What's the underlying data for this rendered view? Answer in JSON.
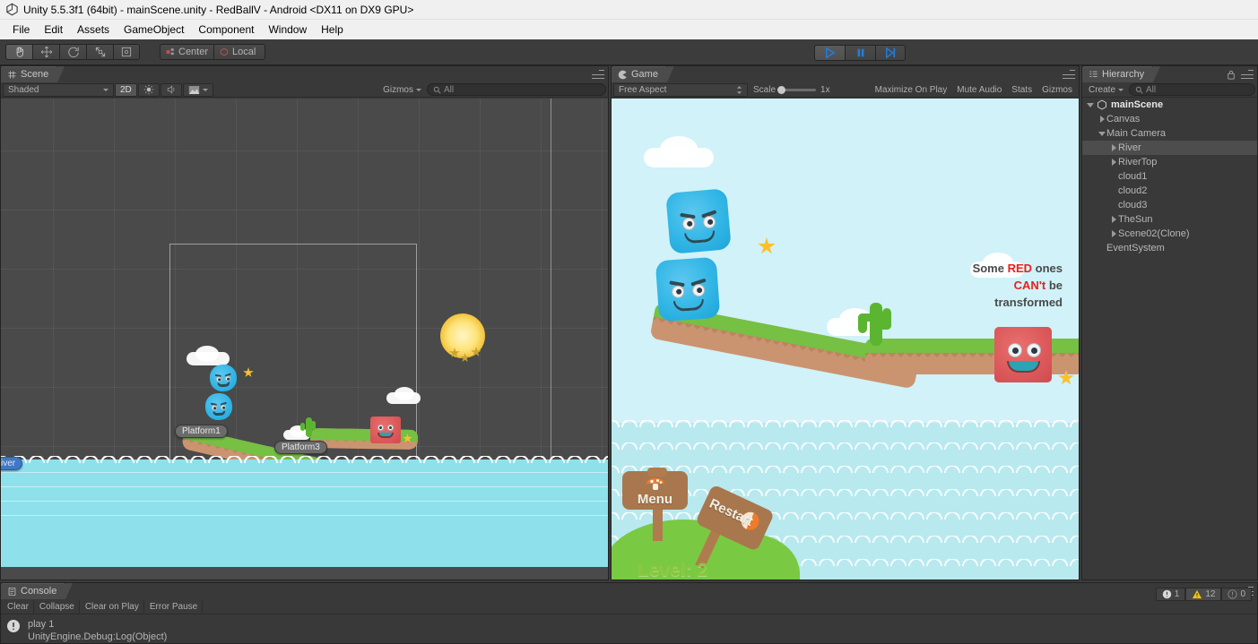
{
  "window": {
    "title": "Unity 5.5.3f1 (64bit) - mainScene.unity - RedBallV - Android <DX11 on DX9 GPU>",
    "logo_icon": "unity-logo-icon"
  },
  "menu": {
    "items": [
      "File",
      "Edit",
      "Assets",
      "GameObject",
      "Component",
      "Window",
      "Help"
    ]
  },
  "toolbar": {
    "tools": [
      {
        "name": "hand-tool",
        "icon": "hand-icon",
        "selected": true
      },
      {
        "name": "move-tool",
        "icon": "move-icon",
        "selected": false
      },
      {
        "name": "rotate-tool",
        "icon": "rotate-icon",
        "selected": false
      },
      {
        "name": "scale-tool",
        "icon": "scale-icon",
        "selected": false
      },
      {
        "name": "rect-tool",
        "icon": "rect-transform-icon",
        "selected": false
      }
    ],
    "pivot_label": "Center",
    "pivot_icon": "pivot-center-icon",
    "space_label": "Local",
    "space_icon": "local-space-icon",
    "play_label": "play-button",
    "pause_label": "pause-button",
    "step_label": "step-button",
    "play_active": true
  },
  "scene_view": {
    "tab_label": "Scene",
    "tab_icon": "scene-grid-icon",
    "shading_mode": "Shaded",
    "toggle_2d": "2D",
    "lighting_icon": "lighting-icon",
    "audio_icon": "audio-icon",
    "fx_icon": "effects-icon",
    "gizmos_label": "Gizmos",
    "search_placeholder": "All",
    "search_icon": "search-icon",
    "gizmo_labels": [
      {
        "name": "gizmo-platform1",
        "text": "Platform1",
        "selected": false
      },
      {
        "name": "gizmo-platform3",
        "text": "Platform3",
        "selected": false
      },
      {
        "name": "gizmo-river",
        "text": "iver",
        "selected": true
      }
    ]
  },
  "game_view": {
    "tab_label": "Game",
    "tab_icon": "game-pacman-icon",
    "aspect": "Free Aspect",
    "scale_label": "Scale",
    "scale_value": "1x",
    "maximize_on_play": "Maximize On Play",
    "mute_audio": "Mute Audio",
    "stats": "Stats",
    "gizmos": "Gizmos",
    "content": {
      "hint_line1_a": "Some ",
      "hint_line1_b": "RED",
      "hint_line1_c": " ones",
      "hint_line2_a": "CAN't",
      "hint_line2_b": " be",
      "hint_line3": "transformed",
      "menu_button": "Menu",
      "menu_icon": "mushroom-icon",
      "restart_button": "Restart",
      "restart_icon": "restart-ball-icon",
      "level_label": "Level: 2",
      "sky_color": "#d0f2f8",
      "water_color": "#b8e9ef",
      "grass_color": "#76c043",
      "dirt_color": "#cb9470",
      "blue_cube_color": "#32b6e6",
      "red_cube_color": "#dd5a5c",
      "star_color": "#fbc02d"
    }
  },
  "hierarchy": {
    "tab_label": "Hierarchy",
    "tab_icon": "hierarchy-icon",
    "lock_icon": "lock-icon",
    "create_label": "Create",
    "search_placeholder": "All",
    "search_icon": "search-icon",
    "items": [
      {
        "label": "mainScene",
        "depth": 0,
        "arrow": "open",
        "selected": false,
        "is_scene": true
      },
      {
        "label": "Canvas",
        "depth": 1,
        "arrow": "closed",
        "selected": false,
        "is_scene": false
      },
      {
        "label": "Main Camera",
        "depth": 1,
        "arrow": "open",
        "selected": false,
        "is_scene": false
      },
      {
        "label": "River",
        "depth": 2,
        "arrow": "closed",
        "selected": true,
        "is_scene": false
      },
      {
        "label": "RiverTop",
        "depth": 2,
        "arrow": "closed",
        "selected": false,
        "is_scene": false
      },
      {
        "label": "cloud1",
        "depth": 2,
        "arrow": "none",
        "selected": false,
        "is_scene": false
      },
      {
        "label": "cloud2",
        "depth": 2,
        "arrow": "none",
        "selected": false,
        "is_scene": false
      },
      {
        "label": "cloud3",
        "depth": 2,
        "arrow": "none",
        "selected": false,
        "is_scene": false
      },
      {
        "label": "TheSun",
        "depth": 2,
        "arrow": "closed",
        "selected": false,
        "is_scene": false
      },
      {
        "label": "Scene02(Clone)",
        "depth": 2,
        "arrow": "closed",
        "selected": false,
        "is_scene": false
      },
      {
        "label": "EventSystem",
        "depth": 1,
        "arrow": "none",
        "selected": false,
        "is_scene": false
      }
    ]
  },
  "console": {
    "tab_label": "Console",
    "tab_icon": "console-icon",
    "buttons": [
      "Clear",
      "Collapse",
      "Clear on Play",
      "Error Pause"
    ],
    "log_icon": "error-icon",
    "log_line1": "play 1",
    "log_line2": "UnityEngine.Debug:Log(Object)",
    "counters": [
      {
        "name": "error-count",
        "icon": "error-icon",
        "value": "1"
      },
      {
        "name": "warning-count",
        "icon": "warning-icon",
        "value": "12"
      },
      {
        "name": "info-count",
        "icon": "info-icon",
        "value": "0"
      }
    ]
  }
}
